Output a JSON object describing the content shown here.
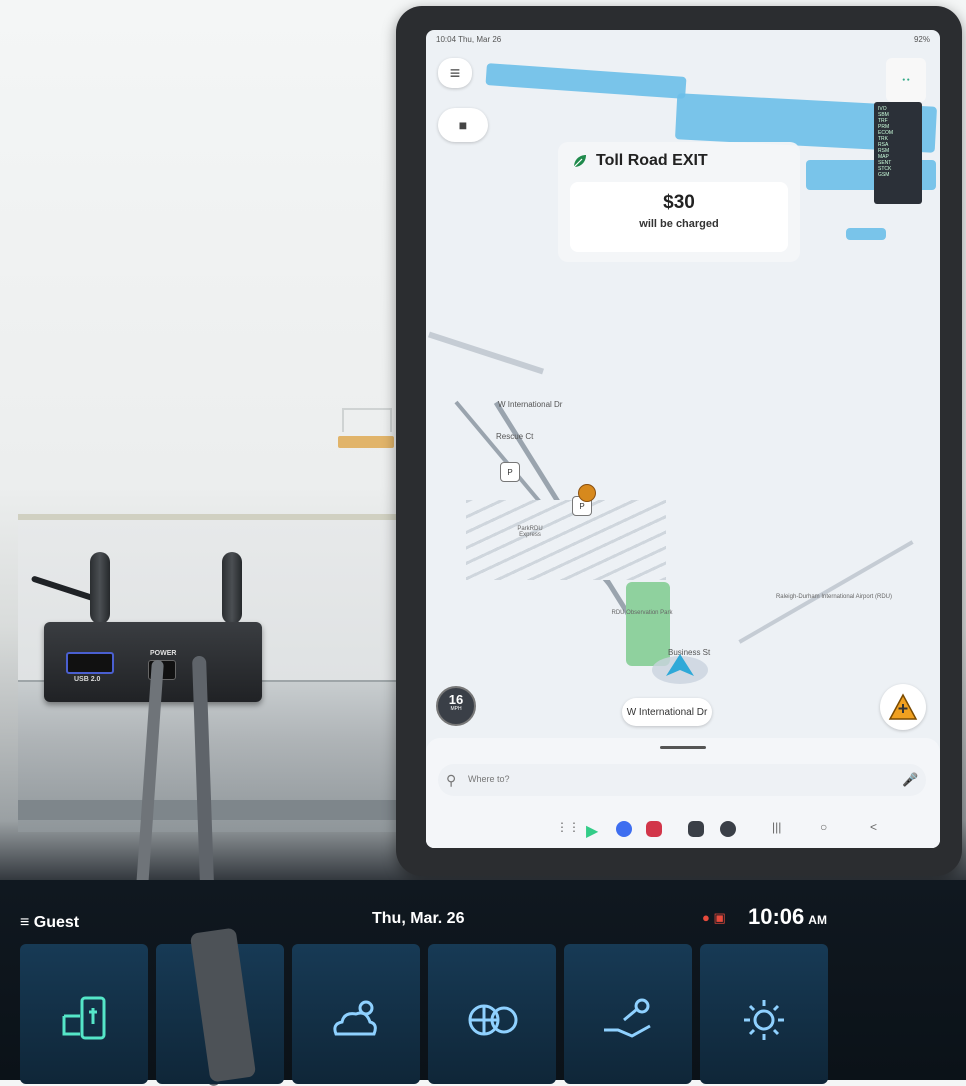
{
  "tablet": {
    "status_bar": {
      "time_date": "10:04 Thu, Mar 26",
      "battery": "92%"
    },
    "toll_card": {
      "title": "Toll Road EXIT",
      "amount": "$30",
      "caption": "will be charged"
    },
    "map_labels": {
      "street_top": "W International Dr",
      "rescue": "Rescue Ct",
      "parking": "ParkRDU Express",
      "observation_park": "RDU Observation Park",
      "business": "Business St",
      "airport": "Raleigh-Durham International Airport (RDU)"
    },
    "speed": {
      "value": "16",
      "unit": "MPH"
    },
    "current_street": "W International Dr",
    "search_placeholder": "Where to?",
    "debug_lines": [
      "IVO",
      "SBM",
      "TRF",
      "PRM",
      "ECOM",
      "TRK",
      "RSA",
      "RSM",
      "MAP",
      "SENT",
      "STCK",
      "GSM"
    ]
  },
  "head_unit": {
    "profile": "Guest",
    "date": "Thu, Mar. 26",
    "time": "10:06",
    "ampm": "AM",
    "tile_icons": [
      "phone-projection-icon",
      "weather-icon",
      "sports-icon",
      "valet-key-icon",
      "settings-icon"
    ]
  },
  "colors": {
    "map_background": "#edf1f5",
    "water": "#6bbfe9",
    "park": "#8fd19e",
    "head_unit_tile": "#173a55",
    "hazard": "#f0a020"
  }
}
